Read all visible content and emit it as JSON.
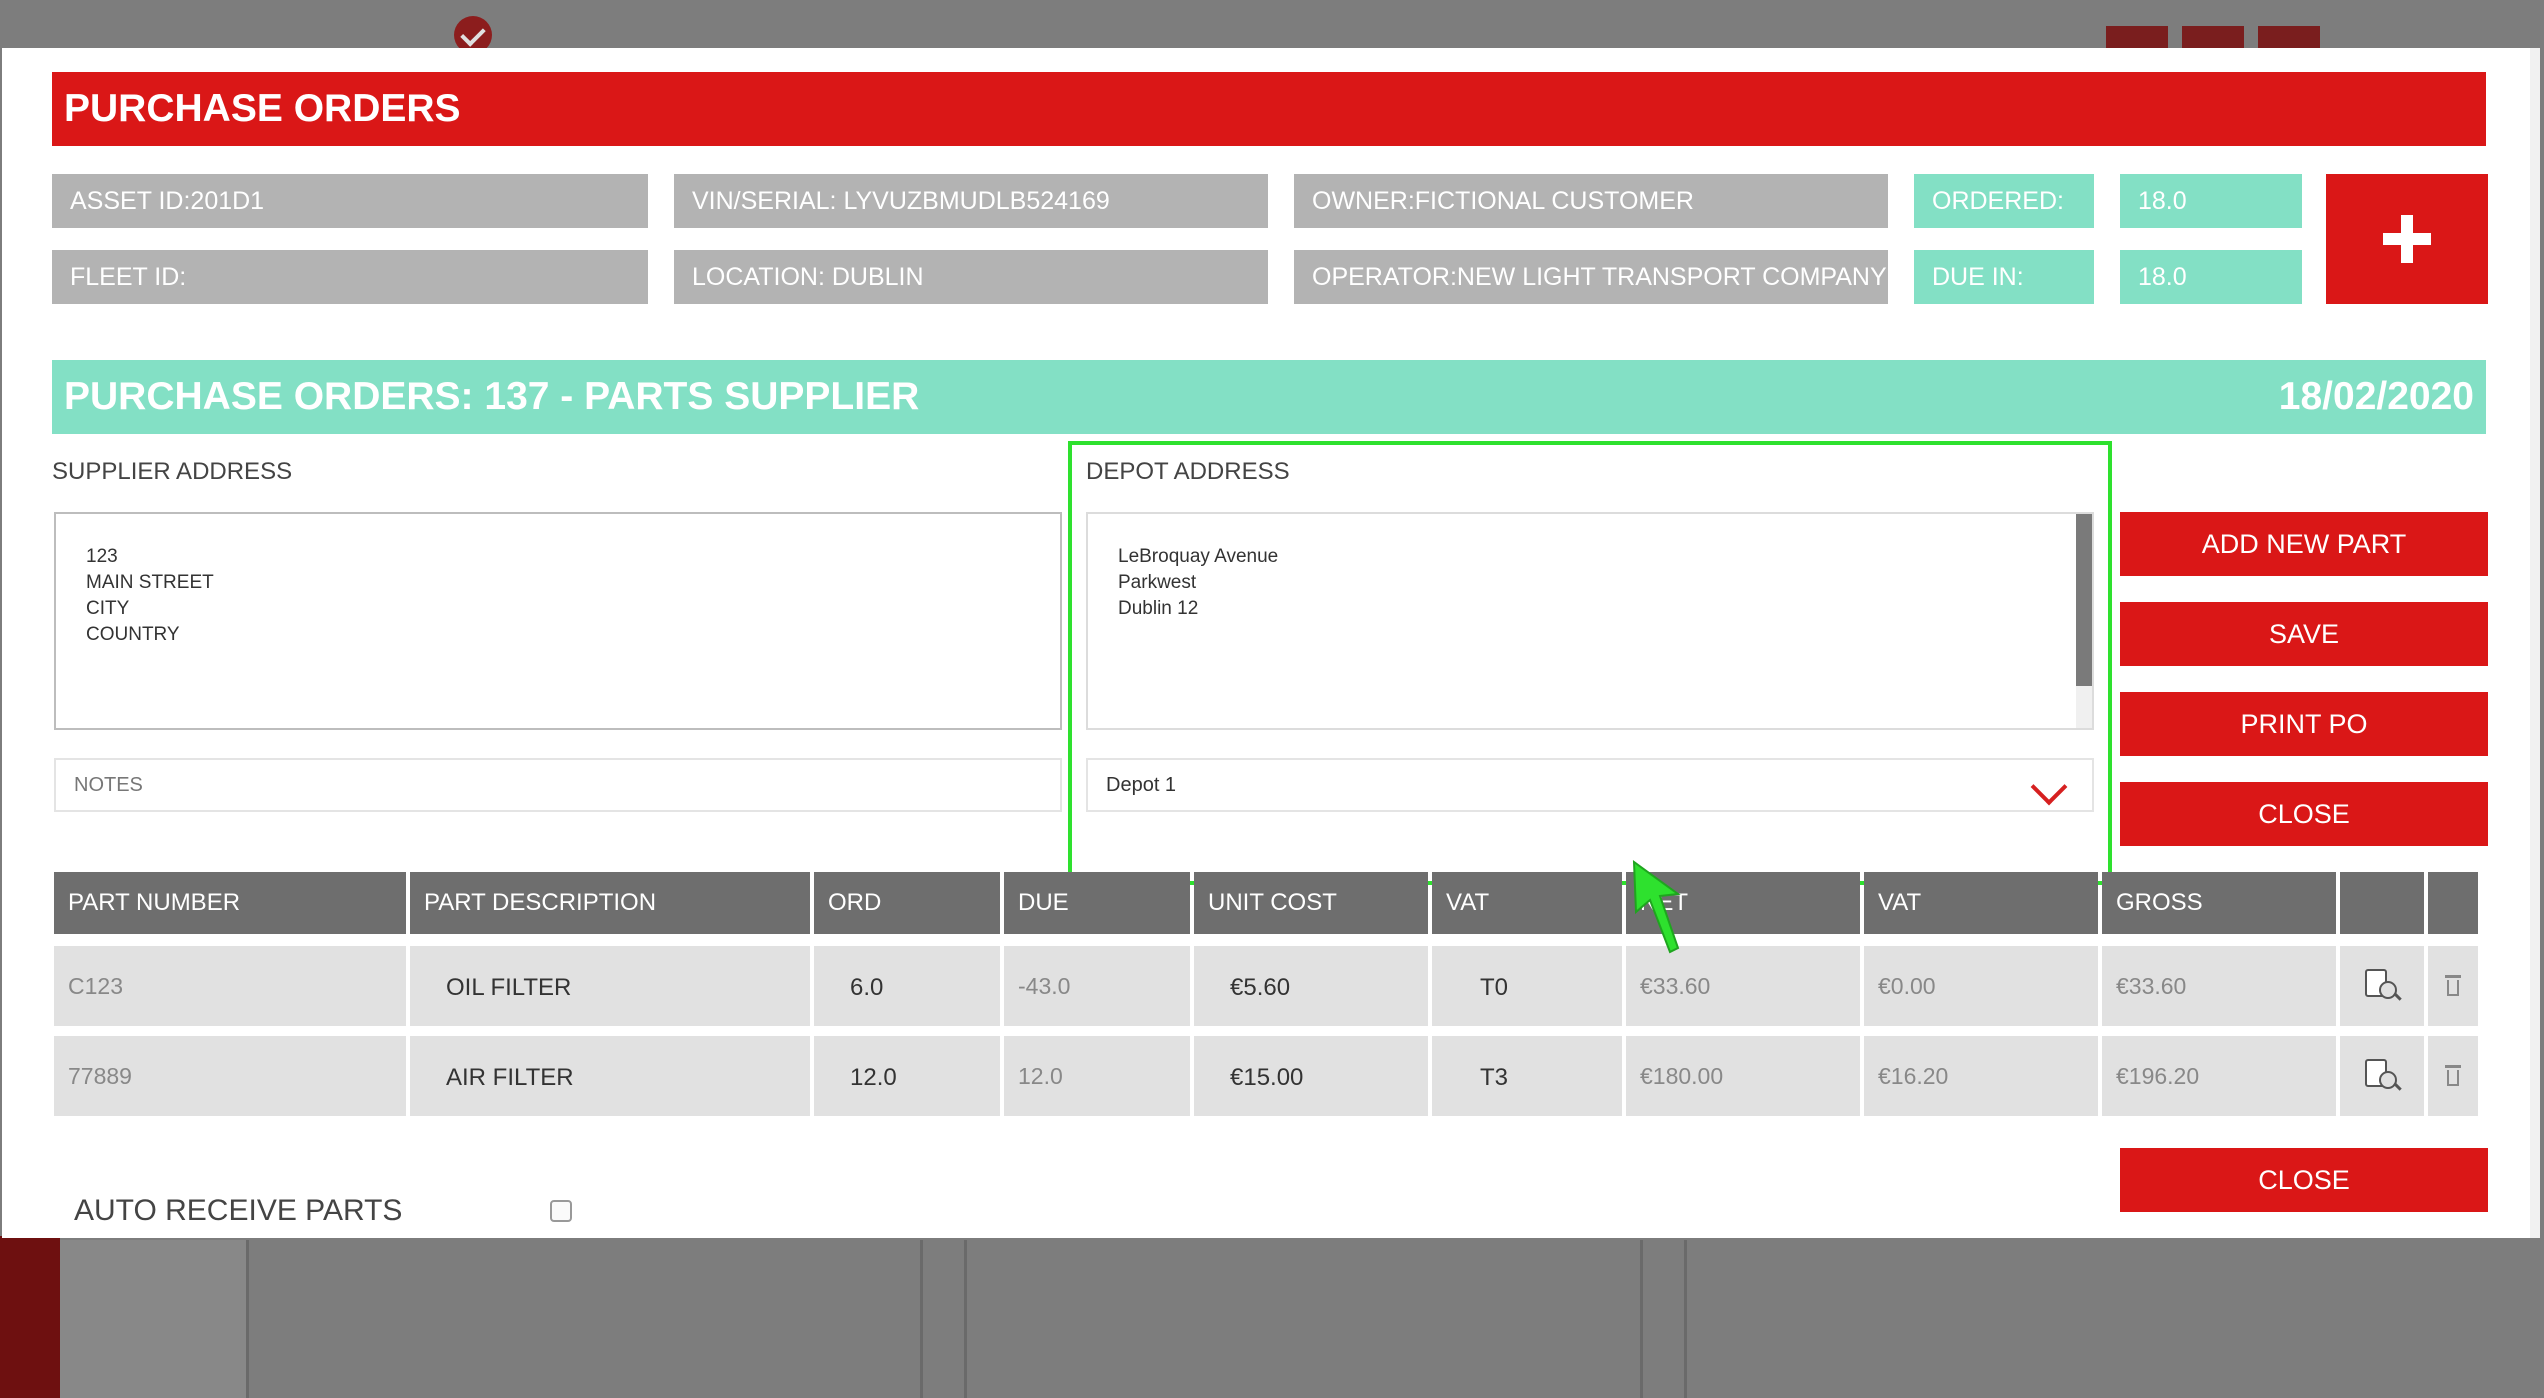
{
  "modal": {
    "title": "PURCHASE ORDERS",
    "info": {
      "asset_id": "ASSET ID:201D1",
      "vin_serial": "VIN/SERIAL: LYVUZBMUDLB524169",
      "owner": "OWNER:FICTIONAL CUSTOMER",
      "ordered_label": "ORDERED:",
      "ordered_value": "18.0",
      "fleet_id": "FLEET ID:",
      "location": "LOCATION: DUBLIN",
      "operator": "OPERATOR:NEW LIGHT TRANSPORT COMPANY",
      "due_in_label": "DUE IN:",
      "due_in_value": "18.0"
    },
    "po_header": {
      "title": "PURCHASE ORDERS: 137 - PARTS SUPPLIER",
      "date": "18/02/2020"
    },
    "supplier_address": {
      "label": "SUPPLIER ADDRESS",
      "lines": [
        "123",
        "MAIN STREET",
        "CITY",
        "COUNTRY"
      ]
    },
    "notes": {
      "placeholder": "NOTES"
    },
    "depot_address": {
      "label": "DEPOT ADDRESS",
      "lines": [
        "LeBroquay Avenue",
        "Parkwest",
        "Dublin 12"
      ],
      "selected_depot": "Depot 1"
    },
    "buttons": {
      "add_new_part": "ADD NEW PART",
      "save": "SAVE",
      "print_po": "PRINT PO",
      "close_top": "CLOSE",
      "close_bottom": "CLOSE"
    },
    "table": {
      "headers": [
        "PART NUMBER",
        "PART DESCRIPTION",
        "ORD",
        "DUE",
        "UNIT COST",
        "VAT",
        "NET",
        "VAT",
        "GROSS",
        "",
        ""
      ],
      "rows": [
        {
          "part_number": "C123",
          "description": "OIL FILTER",
          "ord": "6.0",
          "due": "-43.0",
          "unit_cost": "€5.60",
          "vat_code": "T0",
          "net": "€33.60",
          "vat": "€0.00",
          "gross": "€33.60"
        },
        {
          "part_number": "77889",
          "description": "AIR FILTER",
          "ord": "12.0",
          "due": "12.0",
          "unit_cost": "€15.00",
          "vat_code": "T3",
          "net": "€180.00",
          "vat": "€16.20",
          "gross": "€196.20"
        }
      ]
    },
    "auto_receive": {
      "label": "AUTO RECEIVE PARTS",
      "checked": false
    }
  },
  "colors": {
    "brand_red": "#da1717",
    "teal": "#83e0c5",
    "info_grey": "#b3b3b3",
    "header_grey": "#6e6e6e",
    "highlight_green": "#2ee12e"
  }
}
